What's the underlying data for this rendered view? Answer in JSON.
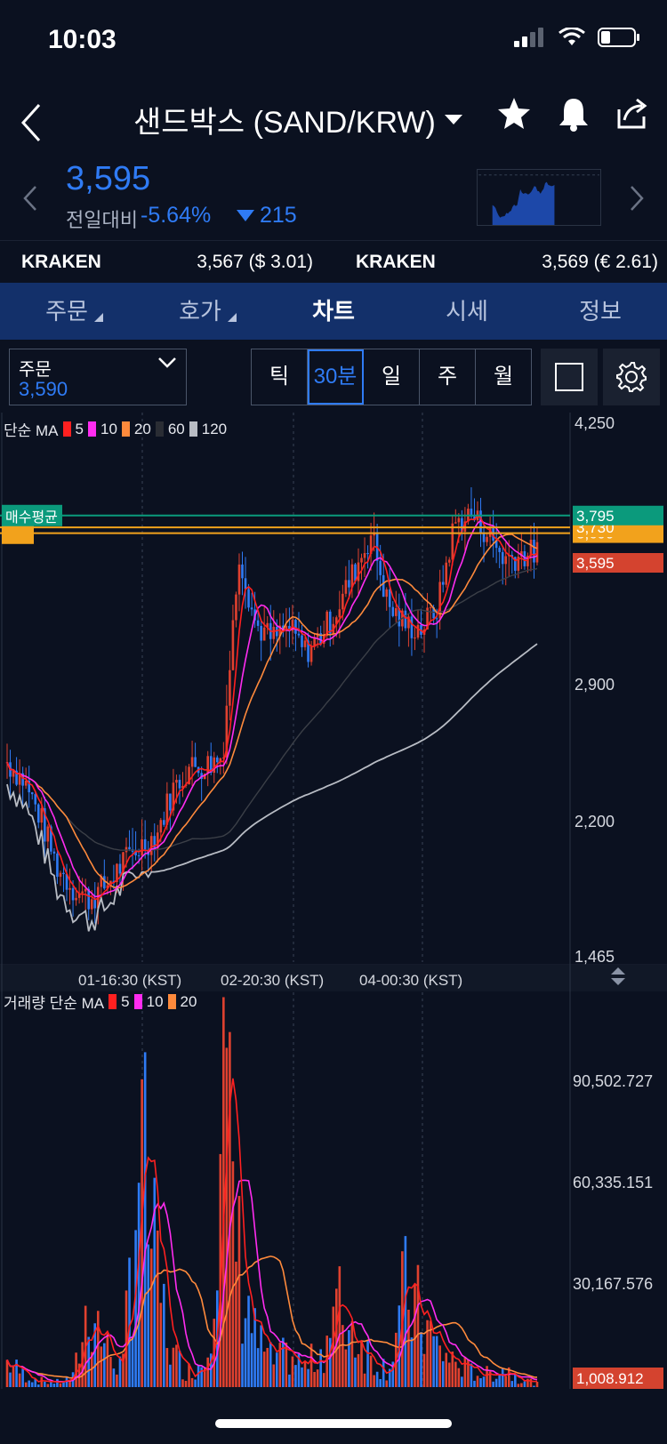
{
  "status": {
    "time": "10:03"
  },
  "header": {
    "title": "샌드박스 (SAND/KRW)"
  },
  "price": {
    "current": "3,595",
    "change_label": "전일대비",
    "change_pct": "-5.64%",
    "change_amt": "215"
  },
  "exchanges": [
    {
      "name": "KRAKEN",
      "value": "3,567 ($ 3.01)"
    },
    {
      "name": "KRAKEN",
      "value": "3,569 (€ 2.61)"
    }
  ],
  "tabs": [
    {
      "label": "주문"
    },
    {
      "label": "호가"
    },
    {
      "label": "차트"
    },
    {
      "label": "시세"
    },
    {
      "label": "정보"
    }
  ],
  "order": {
    "label": "주문",
    "value": "3,590"
  },
  "periods": [
    {
      "label": "틱"
    },
    {
      "label": "30분"
    },
    {
      "label": "일"
    },
    {
      "label": "주"
    },
    {
      "label": "월"
    }
  ],
  "price_legend": {
    "prefix": "단순 MA",
    "ma": [
      "5",
      "10",
      "20",
      "60",
      "120"
    ]
  },
  "volume_legend": {
    "prefix": "거래량 단순 MA",
    "ma": [
      "5",
      "10",
      "20"
    ]
  },
  "price_axis": [
    "4,250",
    "2,900",
    "2,200",
    "1,465"
  ],
  "volume_axis": [
    "90,502.727",
    "60,335.151",
    "30,167.576"
  ],
  "time_axis": [
    "01-16:30 (KST)",
    "02-20:30 (KST)",
    "04-00:30 (KST)"
  ],
  "tags": {
    "avg_label": "매수평균",
    "avg_value": "3,795",
    "upper_value": "3,730",
    "lower_value": "3,699",
    "current_value": "3,595",
    "volume_current": "1,008.912"
  },
  "colors": {
    "up": "#e0412f",
    "down": "#2f7bf5",
    "ma5": "#ff2020",
    "ma10": "#ff2cf0",
    "ma20": "#ff8a3c",
    "ma60": "#2a2d34",
    "ma120": "#b8bcc4",
    "avg_line": "#0b9a7c",
    "order_line": "#f2a21c"
  },
  "chart_data": {
    "type": "candlestick",
    "timeframe": "30분",
    "ylim": [
      1465,
      4250
    ],
    "volume_ylim": [
      0,
      120670
    ],
    "x_tick_labels": [
      "01-16:30 (KST)",
      "02-20:30 (KST)",
      "04-00:30 (KST)"
    ],
    "y_tick_labels": [
      "4,250",
      "2,900",
      "2,200",
      "1,465"
    ],
    "volume_tick_labels": [
      "90,502.727",
      "60,335.151",
      "30,167.576"
    ],
    "closing_anchor": [
      2450,
      2350,
      2150,
      1880,
      1760,
      1700,
      1780,
      1900,
      1990,
      2050,
      2300,
      2420,
      2430,
      2480,
      3600,
      3200,
      3120,
      3180,
      3050,
      3150,
      3300,
      3500,
      3700,
      3300,
      3200,
      3180,
      3300,
      3750,
      3800,
      3700,
      3560,
      3580,
      3595
    ],
    "volume_anchor": [
      8000,
      4000,
      2000,
      1500,
      3000,
      28000,
      12000,
      6000,
      80000,
      35000,
      10000,
      5000,
      9000,
      95000,
      40000,
      15000,
      8000,
      10000,
      6000,
      12000,
      25000,
      18000,
      9000,
      6000,
      30000,
      22000,
      12000,
      8000,
      5000,
      4000,
      6000,
      3000,
      1008
    ]
  }
}
